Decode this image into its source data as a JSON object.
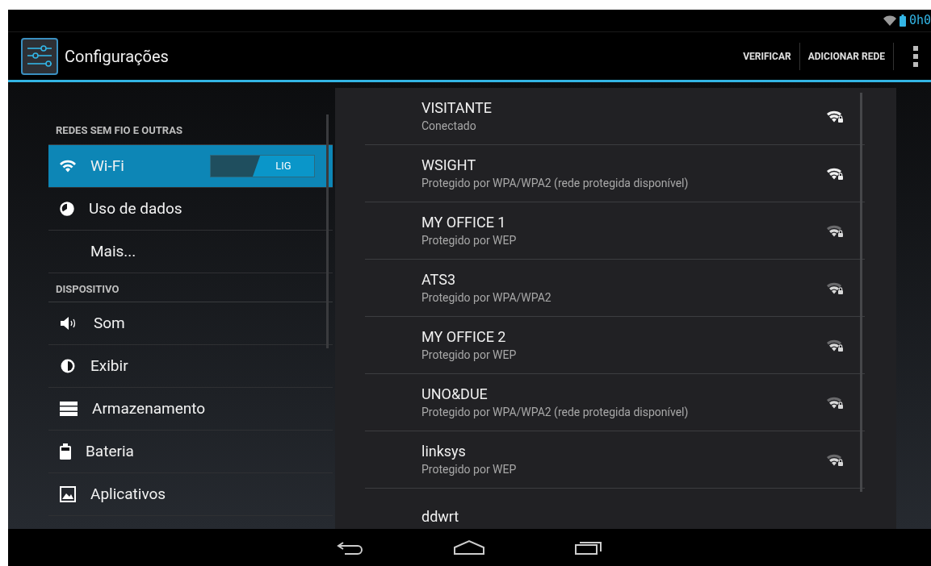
{
  "status_bar": {
    "time": "0h0"
  },
  "action_bar": {
    "title": "Configurações",
    "actions": [
      "VERIFICAR",
      "ADICIONAR REDE"
    ]
  },
  "sidebar": {
    "items": [
      {
        "kind": "header",
        "label": "REDES SEM FIO E OUTRAS"
      },
      {
        "kind": "item",
        "label": "Wi-Fi",
        "selected": true,
        "toggle": {
          "label": "LIG",
          "on": true
        }
      },
      {
        "kind": "item",
        "label": "Uso de dados",
        "selected": false
      },
      {
        "kind": "item",
        "label": "Mais...",
        "selected": false
      },
      {
        "kind": "header",
        "label": "DISPOSITIVO"
      },
      {
        "kind": "item",
        "label": "Som",
        "selected": false
      },
      {
        "kind": "item",
        "label": "Exibir",
        "selected": false
      },
      {
        "kind": "item",
        "label": "Armazenamento",
        "selected": false
      },
      {
        "kind": "item",
        "label": "Bateria",
        "selected": false
      },
      {
        "kind": "item",
        "label": "Aplicativos",
        "selected": false
      }
    ]
  },
  "networks": [
    {
      "name": "VISITANTE",
      "status": "Conectado",
      "kind": "strong"
    },
    {
      "name": "WSIGHT",
      "status": "Protegido por WPA/WPA2 (rede protegida disponível)",
      "kind": "strong"
    },
    {
      "name": "MY OFFICE 1",
      "status": "Protegido por WEP",
      "kind": "weak"
    },
    {
      "name": "ATS3",
      "status": "Protegido por WPA/WPA2",
      "kind": "weak"
    },
    {
      "name": "MY OFFICE 2",
      "status": "Protegido por WEP",
      "kind": "weak"
    },
    {
      "name": "UNO&DUE",
      "status": "Protegido por WPA/WPA2 (rede protegida disponível)",
      "kind": "weak"
    },
    {
      "name": "linksys",
      "status": "Protegido por WEP",
      "kind": "weak"
    },
    {
      "name": "ddwrt"
    }
  ]
}
